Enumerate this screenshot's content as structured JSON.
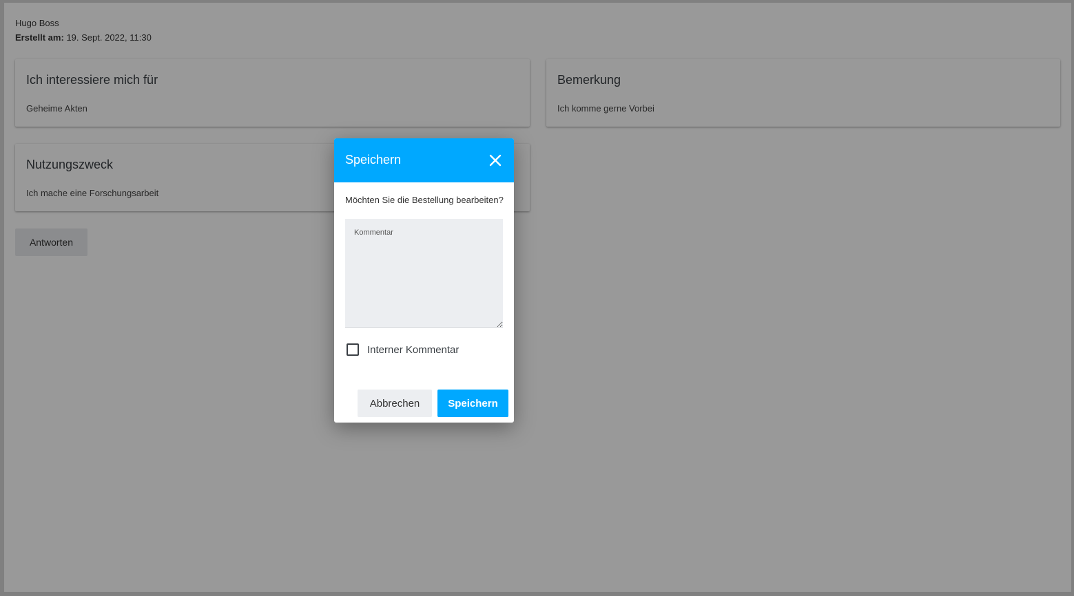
{
  "order": {
    "user_name": "Hugo Boss",
    "created_label": "Erstellt am:",
    "created_value": "19. Sept. 2022, 11:30"
  },
  "cards": {
    "interest": {
      "title": "Ich interessiere mich für",
      "text": "Geheime Akten"
    },
    "remark": {
      "title": "Bemerkung",
      "text": "Ich komme gerne Vorbei"
    },
    "purpose": {
      "title": "Nutzungszweck",
      "text": "Ich mache eine Forschungsarbeit"
    }
  },
  "actions": {
    "answer_label": "Antworten"
  },
  "dialog": {
    "title": "Speichern",
    "question": "Möchten Sie die Bestellung bearbeiten?",
    "comment_label": "Kommentar",
    "comment_value": "",
    "internal_label": "Interner Kommentar",
    "internal_checked": false,
    "cancel_label": "Abbrechen",
    "save_label": "Speichern",
    "icons": {
      "close": "close-icon"
    },
    "accent_color": "#00a8ff"
  }
}
